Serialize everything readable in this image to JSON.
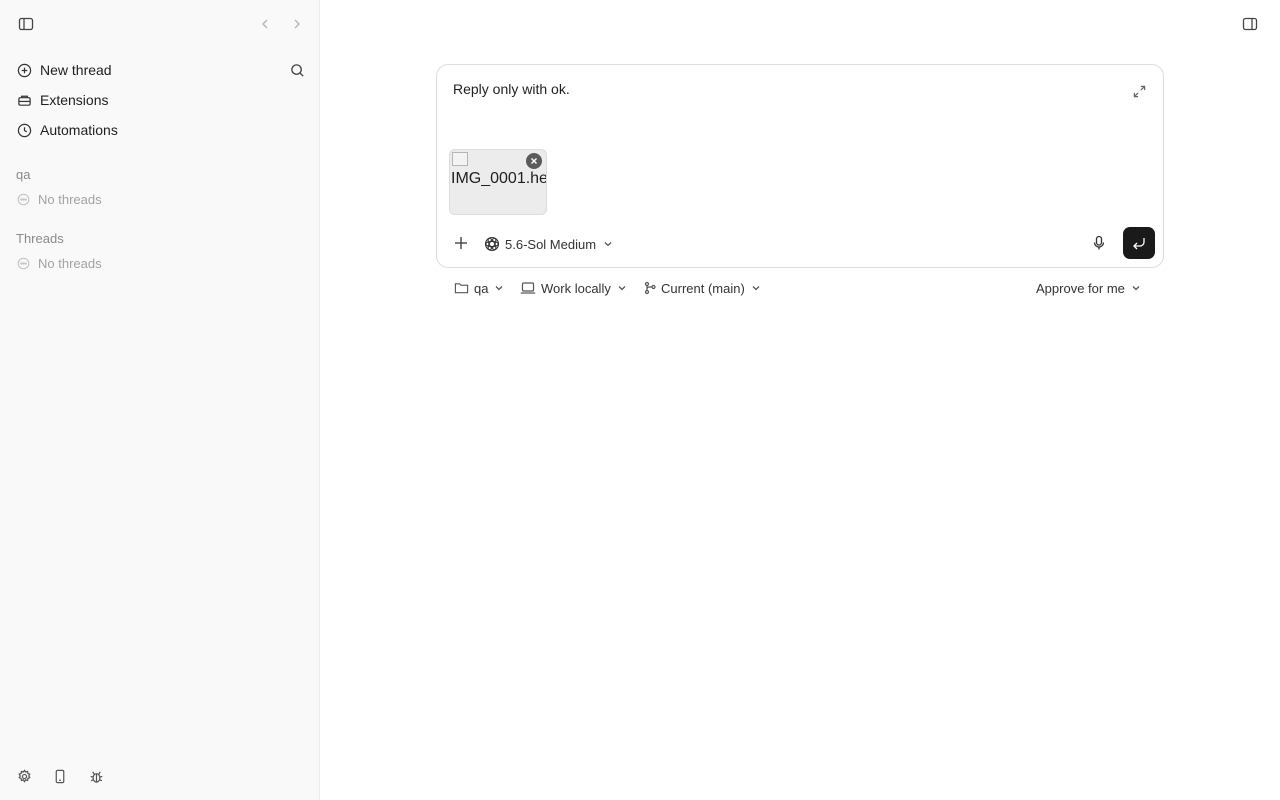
{
  "sidebar": {
    "toggle_icon": "sidebar-toggle-icon",
    "nav": [
      {
        "label": "New thread",
        "icon": "plus-circle-icon"
      },
      {
        "label": "Extensions",
        "icon": "extensions-icon"
      },
      {
        "label": "Automations",
        "icon": "clock-icon"
      }
    ],
    "sections": [
      {
        "label": "qa",
        "empty_text": "No threads"
      },
      {
        "label": "Threads",
        "empty_text": "No threads"
      }
    ]
  },
  "composer": {
    "prompt": "Reply only with ok.",
    "attachment": {
      "filename": "IMG_0001.he"
    },
    "model_label": "5.6-Sol Medium"
  },
  "footer": {
    "project_label": "qa",
    "environment_label": "Work locally",
    "branch_label": "Current (main)",
    "approval_label": "Approve for me"
  },
  "colors": {
    "sidebar_bg": "#f9f9f9",
    "send_button_bg": "#1a1a1a"
  }
}
